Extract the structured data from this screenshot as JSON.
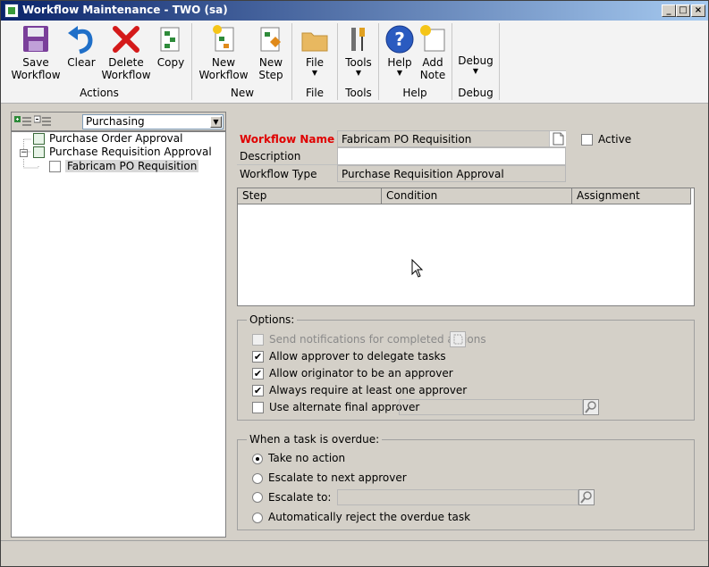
{
  "window": {
    "title": "Workflow Maintenance  -  TWO (sa)",
    "minimize": "_",
    "maximize": "□",
    "close": "×"
  },
  "ribbon": {
    "actions": {
      "group_label": "Actions",
      "save": "Save\nWorkflow",
      "clear": "Clear",
      "delete": "Delete\nWorkflow",
      "copy": "Copy"
    },
    "new": {
      "group_label": "New",
      "new_workflow": "New\nWorkflow",
      "new_step": "New\nStep"
    },
    "file": {
      "group_label": "File",
      "file": "File"
    },
    "tools": {
      "group_label": "Tools",
      "tools": "Tools"
    },
    "help": {
      "group_label": "Help",
      "help": "Help",
      "add_note": "Add\nNote"
    },
    "debug": {
      "group_label": "Debug",
      "debug": "Debug"
    }
  },
  "left": {
    "category": "Purchasing",
    "tree": [
      {
        "label": "Purchase Order Approval"
      },
      {
        "label": "Purchase Requisition Approval"
      },
      {
        "label": "Fabricam PO Requisition"
      }
    ]
  },
  "form": {
    "workflow_name_label": "Workflow Name",
    "workflow_name": "Fabricam PO Requisition",
    "description_label": "Description",
    "description": "",
    "workflow_type_label": "Workflow Type",
    "workflow_type": "Purchase Requisition Approval",
    "active_label": "Active",
    "active": false
  },
  "grid": {
    "columns": [
      "Step",
      "Condition",
      "Assignment"
    ],
    "rows": []
  },
  "options": {
    "title": "Options:",
    "send_notifications": "Send notifications for completed actions",
    "allow_delegate": "Allow approver to delegate tasks",
    "allow_originator": "Allow originator to be an approver",
    "always_require": "Always require at least one approver",
    "alternate_final": "Use alternate final approver",
    "alternate_value": ""
  },
  "overdue": {
    "title": "When a task is overdue:",
    "take_no_action": "Take no action",
    "escalate_next": "Escalate to next approver",
    "escalate_to": "Escalate to:",
    "escalate_value": "",
    "auto_reject": "Automatically reject the overdue task"
  },
  "colors": {
    "title_start": "#0a246a",
    "title_end": "#a6caf0",
    "required_label": "#e00000",
    "window_bg": "#d4d0c8"
  }
}
